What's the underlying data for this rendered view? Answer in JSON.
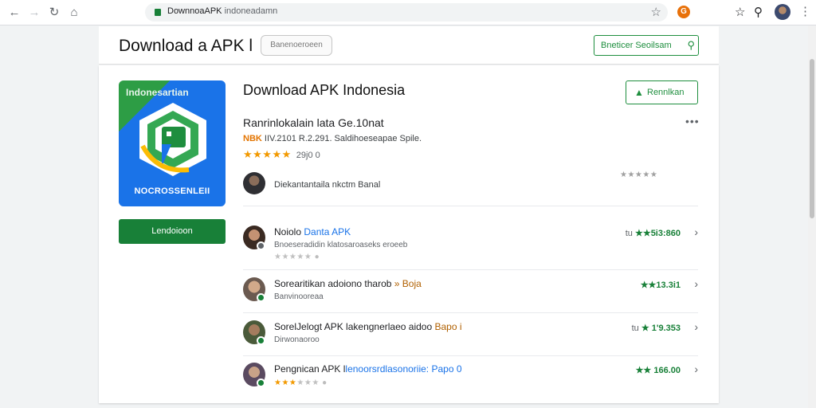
{
  "browser": {
    "url": "DownnoaAPK",
    "url_host": "indoneadamn",
    "ext_label": "G"
  },
  "header": {
    "site_title": "Download a APK l",
    "pill_label": "Banenoeroeen",
    "search_label": "Bneticer Seoilsam"
  },
  "app": {
    "icon_top_text": "Indonesartian",
    "icon_bottom_text": "NOCROSSENLEII",
    "download_label": "Lendoioon",
    "title": "Download APK Indonesia",
    "install_label": "Rennlkan",
    "subtitle": "Ranrinlokalain lata Ge.10nat",
    "meta_tag": "NBK",
    "meta_text": " IIV.2101 R.2.291. Saldihoeseapae Spile.",
    "stars": "★★★★★",
    "rating_count": "29j0 0",
    "developer_text": "Diekantantaila nkctm Banal",
    "developer_stars": "★★★★★"
  },
  "reviews": [
    {
      "title_main": "Noiolo",
      "title_accent": "Danta APK",
      "accent_class": "blue",
      "subtitle": "Bnoeseradidin klatosaroaseks eroeeb",
      "stars_on": "",
      "stars_off": "★★★★★",
      "score_prefix": "tu ",
      "score": "★★5i3:860",
      "badge": "grey"
    },
    {
      "title_main": "Sorearitikan adoiono tharob ",
      "title_accent": "» Boja",
      "accent_class": "orange",
      "subtitle": "Banvinooreaa",
      "stars_on": "",
      "stars_off": "",
      "score_prefix": "",
      "score": "★★13.3i1",
      "badge": "green"
    },
    {
      "title_main": "SorelJelogt APK lakengnerlaeo aidoo",
      "title_accent": " Bapo i",
      "accent_class": "orange",
      "subtitle": "Dirwonaoroo",
      "stars_on": "",
      "stars_off": "",
      "score_prefix": "tu ",
      "score": "★ 1'9.353",
      "badge": "green"
    },
    {
      "title_main": "Pengnican APK l",
      "title_accent": "lenoorsrdlasonoriie: Papo 0",
      "accent_class": "blue",
      "subtitle": "",
      "stars_on": "★★★",
      "stars_off": "★★★",
      "score_prefix": "",
      "score": "★★ 166.00",
      "badge": "green"
    }
  ],
  "colors": {
    "accent_green": "#188038",
    "link_blue": "#1a73e8",
    "star_orange": "#f29900"
  }
}
